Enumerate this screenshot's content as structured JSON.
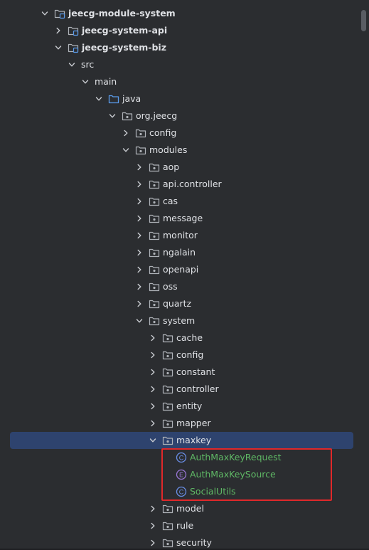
{
  "colors": {
    "background": "#2b2d30",
    "selection": "#2e436e",
    "highlight_border": "#e0282a",
    "text": "#dfe1e5",
    "class_text": "#5fb865",
    "class_icon": "#6a8fe8",
    "enum_icon": "#9a77d6",
    "folder_icon": "#aeb2b8",
    "source_folder_icon": "#5a9bea"
  },
  "tree": {
    "rows": [
      {
        "label": "jeecg-module-system",
        "depth": 0,
        "expanded": true,
        "icon": "module-folder-icon",
        "bold": true
      },
      {
        "label": "jeecg-system-api",
        "depth": 1,
        "expanded": false,
        "icon": "module-folder-icon",
        "bold": true
      },
      {
        "label": "jeecg-system-biz",
        "depth": 1,
        "expanded": true,
        "icon": "module-folder-icon",
        "bold": true
      },
      {
        "label": "src",
        "depth": 2,
        "expanded": true,
        "icon": "none"
      },
      {
        "label": "main",
        "depth": 3,
        "expanded": true,
        "icon": "none"
      },
      {
        "label": "java",
        "depth": 4,
        "expanded": true,
        "icon": "source-folder-icon"
      },
      {
        "label": "org.jeecg",
        "depth": 5,
        "expanded": true,
        "icon": "package-icon"
      },
      {
        "label": "config",
        "depth": 6,
        "expanded": false,
        "icon": "package-icon"
      },
      {
        "label": "modules",
        "depth": 6,
        "expanded": true,
        "icon": "package-icon"
      },
      {
        "label": "aop",
        "depth": 7,
        "expanded": false,
        "icon": "package-icon"
      },
      {
        "label": "api.controller",
        "depth": 7,
        "expanded": false,
        "icon": "package-icon"
      },
      {
        "label": "cas",
        "depth": 7,
        "expanded": false,
        "icon": "package-icon"
      },
      {
        "label": "message",
        "depth": 7,
        "expanded": false,
        "icon": "package-icon"
      },
      {
        "label": "monitor",
        "depth": 7,
        "expanded": false,
        "icon": "package-icon"
      },
      {
        "label": "ngalain",
        "depth": 7,
        "expanded": false,
        "icon": "package-icon"
      },
      {
        "label": "openapi",
        "depth": 7,
        "expanded": false,
        "icon": "package-icon"
      },
      {
        "label": "oss",
        "depth": 7,
        "expanded": false,
        "icon": "package-icon"
      },
      {
        "label": "quartz",
        "depth": 7,
        "expanded": false,
        "icon": "package-icon"
      },
      {
        "label": "system",
        "depth": 7,
        "expanded": true,
        "icon": "package-icon"
      },
      {
        "label": "cache",
        "depth": 8,
        "expanded": false,
        "icon": "package-icon"
      },
      {
        "label": "config",
        "depth": 8,
        "expanded": false,
        "icon": "package-icon"
      },
      {
        "label": "constant",
        "depth": 8,
        "expanded": false,
        "icon": "package-icon"
      },
      {
        "label": "controller",
        "depth": 8,
        "expanded": false,
        "icon": "package-icon"
      },
      {
        "label": "entity",
        "depth": 8,
        "expanded": false,
        "icon": "package-icon"
      },
      {
        "label": "mapper",
        "depth": 8,
        "expanded": false,
        "icon": "package-icon"
      },
      {
        "label": "maxkey",
        "depth": 8,
        "expanded": true,
        "icon": "package-icon",
        "selected": true
      },
      {
        "label": "AuthMaxKeyRequest",
        "depth": 9,
        "leaf": true,
        "icon": "class-icon",
        "kind": "class"
      },
      {
        "label": "AuthMaxKeySource",
        "depth": 9,
        "leaf": true,
        "icon": "enum-icon",
        "kind": "enum"
      },
      {
        "label": "SocialUtils",
        "depth": 9,
        "leaf": true,
        "icon": "class-icon",
        "kind": "class"
      },
      {
        "label": "model",
        "depth": 8,
        "expanded": false,
        "icon": "package-icon"
      },
      {
        "label": "rule",
        "depth": 8,
        "expanded": false,
        "icon": "package-icon"
      },
      {
        "label": "security",
        "depth": 8,
        "expanded": false,
        "icon": "package-icon"
      }
    ]
  }
}
